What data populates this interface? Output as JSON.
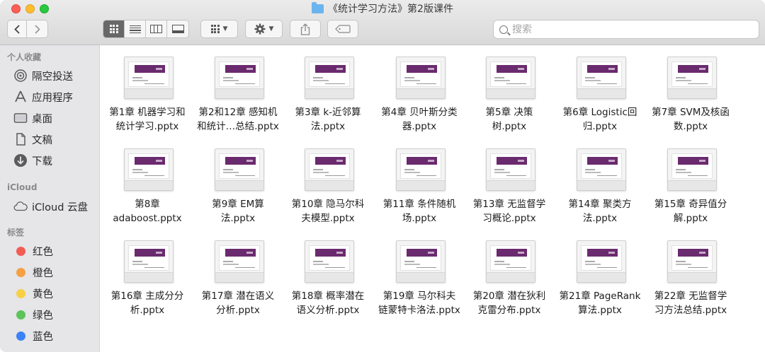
{
  "window": {
    "title": "《统计学习方法》第2版课件",
    "folder_icon": "folder-icon",
    "search_placeholder": "搜索"
  },
  "toolbar": {
    "back_icon": "chevron-left-icon",
    "forward_icon": "chevron-right-icon",
    "view_modes": [
      "icon-view",
      "list-view",
      "column-view",
      "gallery-view"
    ],
    "active_view": "icon-view"
  },
  "sidebar": {
    "favorites_header": "个人收藏",
    "favorites": [
      {
        "label": "隔空投送",
        "icon": "airdrop-icon"
      },
      {
        "label": "应用程序",
        "icon": "applications-icon"
      },
      {
        "label": "桌面",
        "icon": "desktop-icon"
      },
      {
        "label": "文稿",
        "icon": "documents-icon"
      },
      {
        "label": "下载",
        "icon": "downloads-icon"
      }
    ],
    "icloud_header": "iCloud",
    "icloud": [
      {
        "label": "iCloud 云盘",
        "icon": "cloud-icon"
      }
    ],
    "tags_header": "标签",
    "tags": [
      {
        "label": "红色",
        "color": "#f25c54"
      },
      {
        "label": "橙色",
        "color": "#f5a043"
      },
      {
        "label": "黄色",
        "color": "#f7d046"
      },
      {
        "label": "绿色",
        "color": "#5ec35a"
      },
      {
        "label": "蓝色",
        "color": "#3b82f6"
      }
    ]
  },
  "files": [
    {
      "line1": "第1章 机器学习和",
      "line2": "统计学习.pptx"
    },
    {
      "line1": "第2和12章 感知机",
      "line2": "和统计…总结.pptx"
    },
    {
      "line1": "第3章 k-近邻算",
      "line2": "法.pptx"
    },
    {
      "line1": "第4章 贝叶斯分类",
      "line2": "器.pptx"
    },
    {
      "line1": "第5章 决策",
      "line2": "树.pptx"
    },
    {
      "line1": "第6章 Logistic回",
      "line2": "归.pptx"
    },
    {
      "line1": "第7章 SVM及核函",
      "line2": "数.pptx"
    },
    {
      "line1": "第8章",
      "line2": "adaboost.pptx"
    },
    {
      "line1": "第9章 EM算",
      "line2": "法.pptx"
    },
    {
      "line1": "第10章 隐马尔科",
      "line2": "夫模型.pptx"
    },
    {
      "line1": "第11章 条件随机",
      "line2": "场.pptx"
    },
    {
      "line1": "第13章 无监督学",
      "line2": "习概论.pptx"
    },
    {
      "line1": "第14章 聚类方",
      "line2": "法.pptx"
    },
    {
      "line1": "第15章 奇异值分",
      "line2": "解.pptx"
    },
    {
      "line1": "第16章 主成分分",
      "line2": "析.pptx"
    },
    {
      "line1": "第17章 潜在语义",
      "line2": "分析.pptx"
    },
    {
      "line1": "第18章  概率潜在",
      "line2": "语义分析.pptx"
    },
    {
      "line1": "第19章  马尔科夫",
      "line2": "链蒙特卡洛法.pptx"
    },
    {
      "line1": "第20章  潜在狄利",
      "line2": "克雷分布.pptx"
    },
    {
      "line1": "第21章 PageRank",
      "line2": "算法.pptx"
    },
    {
      "line1": "第22章 无监督学",
      "line2": "习方法总结.pptx"
    }
  ]
}
